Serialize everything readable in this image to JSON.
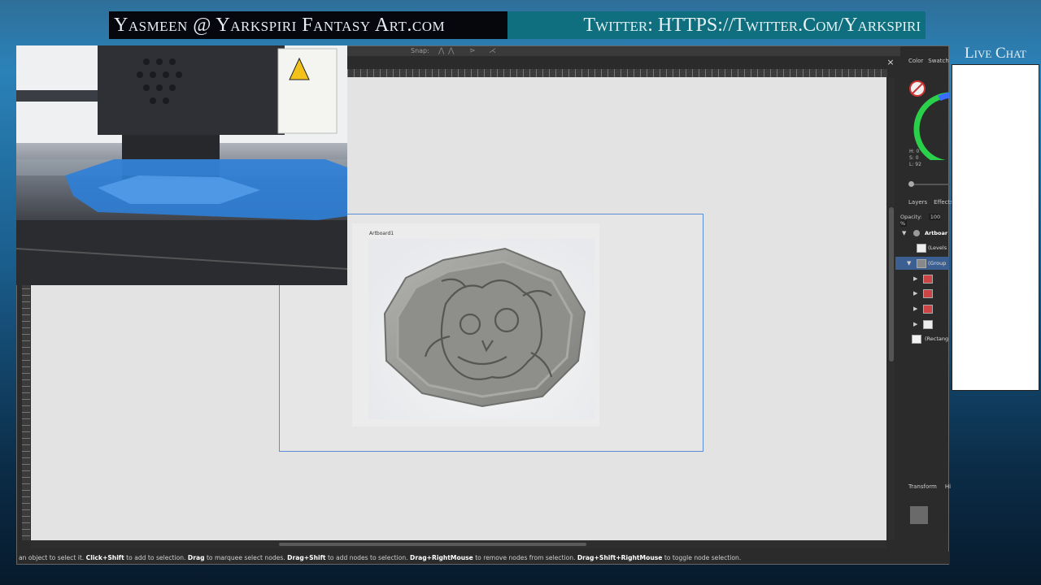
{
  "banner": {
    "left_text": "Yasmeen @ Yarkspiri Fantasy Art.com",
    "right_text": "Twitter: HTTPS://Twitter.Com/Yarkspiri"
  },
  "live_chat": {
    "title": "Live Chat"
  },
  "toolbar": {
    "snap_label": "Snap:"
  },
  "document": {
    "close_glyph": "×",
    "artboard_label": "Artboard1"
  },
  "panels": {
    "color_tab": "Color",
    "swatches_tab": "Swatch",
    "hsl": {
      "h": "H: 0",
      "s": "S: 0",
      "l": "L: 92"
    },
    "layers_tab": "Layers",
    "effects_tab": "Effects",
    "opacity_label": "Opacity:",
    "opacity_value": "100 %",
    "layers": [
      {
        "label": "Artboar"
      },
      {
        "label": "(Levels"
      },
      {
        "label": "(Group"
      },
      {
        "label": ""
      },
      {
        "label": ""
      },
      {
        "label": ""
      },
      {
        "label": ""
      },
      {
        "label": "(Rectang"
      }
    ],
    "transform_tab": "Transform",
    "history_tab": "Hi"
  },
  "status": {
    "p1": "an object to select it.",
    "k1": "Click+Shift",
    "p2": "to add to selection.",
    "k2": "Drag",
    "p3": "to marquee select nodes.",
    "k3": "Drag+Shift",
    "p4": "to add nodes to selection.",
    "k4": "Drag+RightMouse",
    "p5": "to remove nodes from selection.",
    "k5": "Drag+Shift+RightMouse",
    "p6": "to toggle node selection."
  },
  "colors": {
    "accent_selection": "#5b8ed6",
    "layer_selected": "#3c5f91",
    "banner_right_bg": "#0f6f7f"
  }
}
